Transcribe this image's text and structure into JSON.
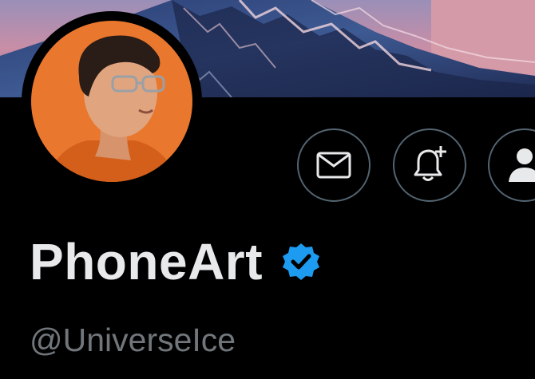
{
  "banner": {
    "description": "mountain-artwork-banner"
  },
  "profile": {
    "display_name": "PhoneArt",
    "handle": "@UniverseIce",
    "verified": true,
    "avatar_bg_color": "#e9772e"
  },
  "actions": {
    "message_icon": "envelope-icon",
    "notify_icon": "bell-plus-icon",
    "follow_icon": "person-icon"
  },
  "colors": {
    "background": "#000000",
    "name": "#e7e9ea",
    "handle": "#71767b",
    "button_border": "#536471",
    "verified_badge": "#1d9bf0"
  }
}
